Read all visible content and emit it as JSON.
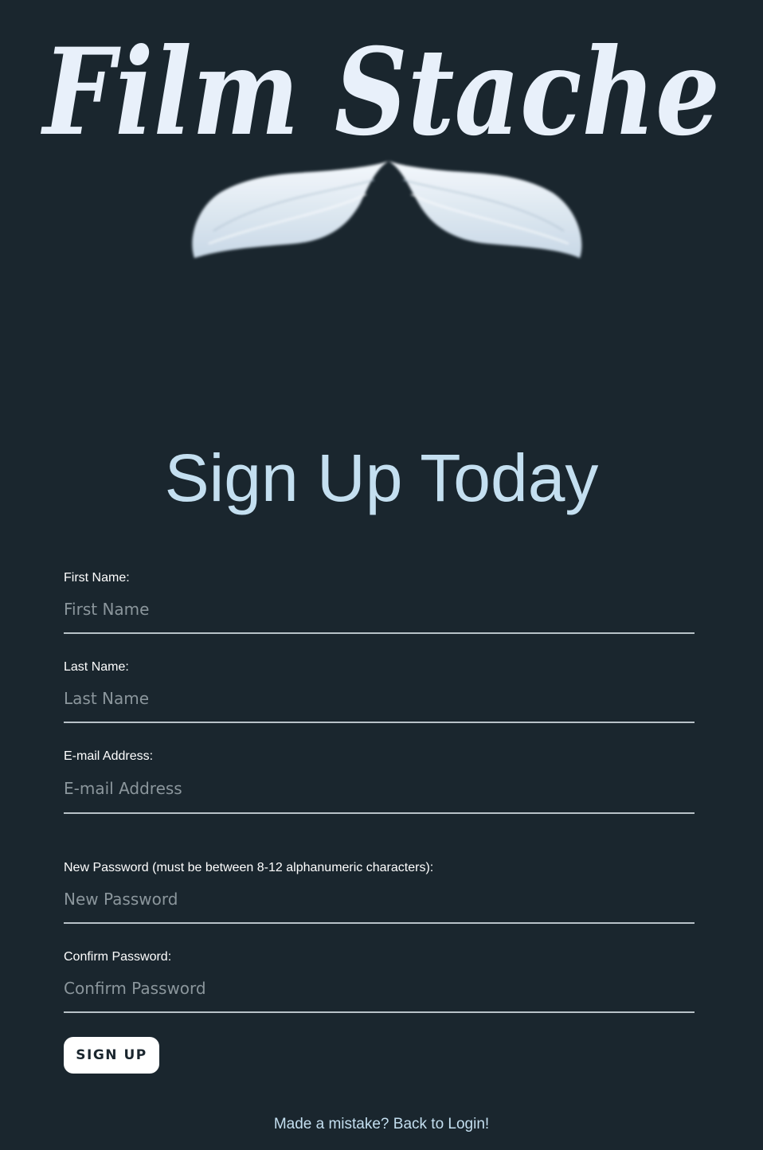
{
  "logo": {
    "text": "Film Stache",
    "icon": "mustache-icon"
  },
  "page_title": "Sign Up Today",
  "form": {
    "first_name": {
      "label": "First Name:",
      "placeholder": "First Name",
      "value": ""
    },
    "last_name": {
      "label": "Last Name:",
      "placeholder": "Last Name",
      "value": ""
    },
    "email": {
      "label": "E-mail Address:",
      "placeholder": "E-mail Address",
      "value": ""
    },
    "new_password": {
      "label": "New Password (must be between 8-12 alphanumeric characters):",
      "placeholder": "New Password",
      "value": ""
    },
    "confirm_password": {
      "label": "Confirm Password:",
      "placeholder": "Confirm Password",
      "value": ""
    },
    "submit_label": "SIGN UP"
  },
  "footer": {
    "back_link": "Made a mistake? Back to Login!"
  },
  "colors": {
    "background": "#1a262e",
    "title": "#c4dff0",
    "logo": "#e8f0fa",
    "button_bg": "#ffffff"
  }
}
